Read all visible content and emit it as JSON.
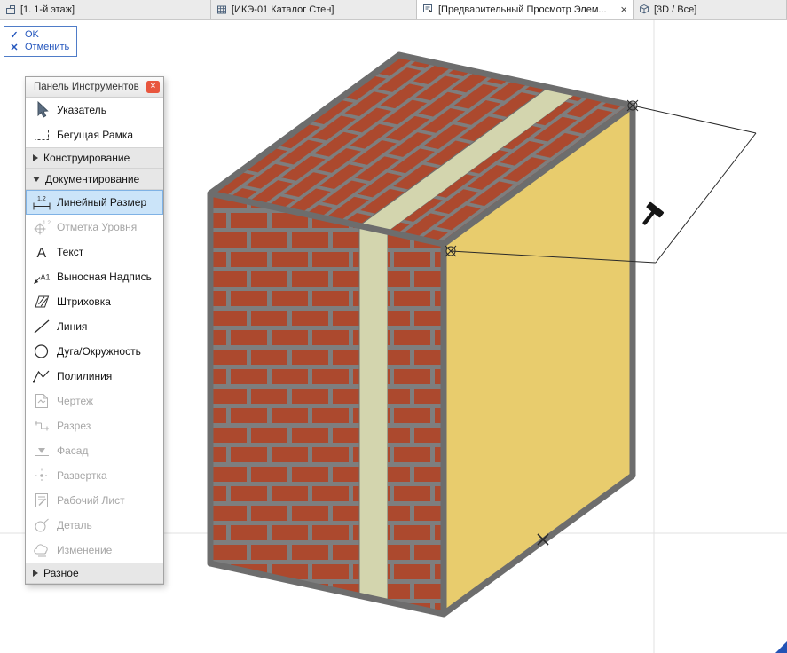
{
  "tabs": {
    "items": [
      {
        "label": "[1. 1-й этаж]",
        "icon": "floorplan-icon",
        "active": false
      },
      {
        "label": "[ИКЭ-01 Каталог Стен]",
        "icon": "grid-icon",
        "active": false
      },
      {
        "label": "[Предварительный Просмотр Элем...",
        "icon": "preview-icon",
        "active": true,
        "close_glyph": "×"
      },
      {
        "label": "[3D / Все]",
        "icon": "cube-icon",
        "active": false
      }
    ]
  },
  "confirm": {
    "ok_glyph": "✓",
    "ok_label": "OK",
    "cancel_glyph": "✕",
    "cancel_label": "Отменить"
  },
  "tool_panel": {
    "title": "Панель Инструментов",
    "close_glyph": "×",
    "items": [
      {
        "label": "Указатель",
        "state": "normal",
        "icon": "pointer-icon"
      },
      {
        "label": "Бегущая Рамка",
        "state": "normal",
        "icon": "marquee-icon"
      },
      {
        "label": "Конструирование",
        "type": "section",
        "expanded": false
      },
      {
        "label": "Документирование",
        "type": "section",
        "expanded": true
      },
      {
        "label": "Линейный Размер",
        "state": "selected",
        "icon": "linear-dimension-icon"
      },
      {
        "label": "Отметка Уровня",
        "state": "disabled",
        "icon": "level-mark-icon"
      },
      {
        "label": "Текст",
        "state": "normal",
        "icon": "text-icon"
      },
      {
        "label": "Выносная Надпись",
        "state": "normal",
        "icon": "callout-icon"
      },
      {
        "label": "Штриховка",
        "state": "normal",
        "icon": "hatch-icon"
      },
      {
        "label": "Линия",
        "state": "normal",
        "icon": "line-icon"
      },
      {
        "label": "Дуга/Окружность",
        "state": "normal",
        "icon": "circle-icon"
      },
      {
        "label": "Полилиния",
        "state": "normal",
        "icon": "polyline-icon"
      },
      {
        "label": "Чертеж",
        "state": "disabled",
        "icon": "drawing-icon"
      },
      {
        "label": "Разрез",
        "state": "disabled",
        "icon": "section-mark-icon"
      },
      {
        "label": "Фасад",
        "state": "disabled",
        "icon": "elevation-icon"
      },
      {
        "label": "Развертка",
        "state": "disabled",
        "icon": "interior-elevation-icon"
      },
      {
        "label": "Рабочий Лист",
        "state": "disabled",
        "icon": "worksheet-icon"
      },
      {
        "label": "Деталь",
        "state": "disabled",
        "icon": "detail-icon"
      },
      {
        "label": "Изменение",
        "state": "disabled",
        "icon": "change-icon"
      },
      {
        "label": "Разное",
        "type": "section",
        "expanded": false
      }
    ]
  },
  "icon_glyphs": {
    "dimension_value": "1.2",
    "level_value": "1.2",
    "text_tool": "A",
    "label_tool": "A1"
  },
  "canvas": {
    "content": "3d-preview-of-composite-brick-wall",
    "colors": {
      "brick": "#ac492e",
      "mortar": "#7e7e7e",
      "edge": "#6d6d6d",
      "insulation": "#e8cc6d",
      "membrane": "#d3d5ae",
      "axis": "#e2e2e2",
      "selection": "#cbe4f9",
      "accent_blue": "#2456bd",
      "close_red": "#e8563e"
    }
  }
}
